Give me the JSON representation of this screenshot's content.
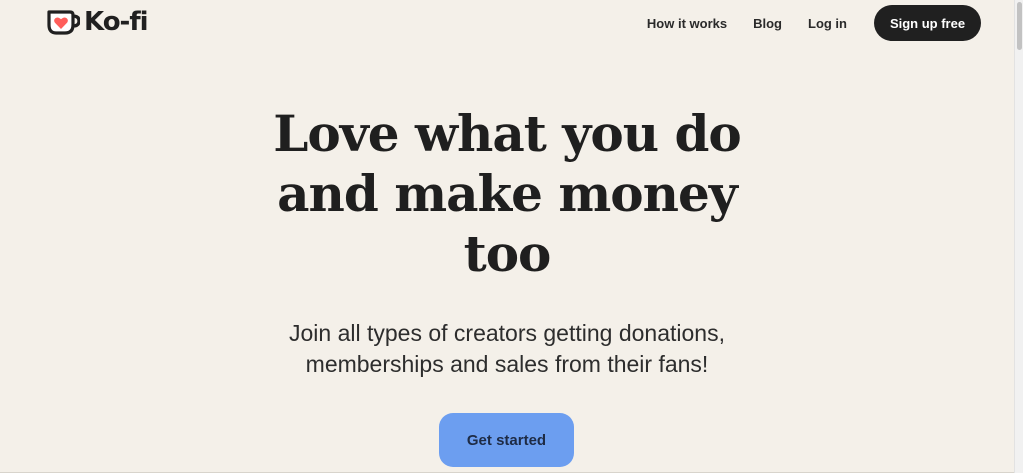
{
  "brand": {
    "name": "Ko-fi",
    "accent_color": "#ff5e5b",
    "icon": "coffee-cup-heart-icon"
  },
  "nav": {
    "links": [
      "How it works",
      "Blog",
      "Log in"
    ],
    "signup_label": "Sign up free"
  },
  "hero": {
    "title_lines": [
      "Love what you do",
      "and make money",
      "too"
    ],
    "subtitle_lines": [
      "Join all types of creators getting donations,",
      "memberships and sales from their fans!"
    ],
    "cta_label": "Get started"
  },
  "colors": {
    "background": "#f4f0e9",
    "text": "#202020",
    "cta": "#6c9ef0",
    "signup_button": "#202020"
  }
}
